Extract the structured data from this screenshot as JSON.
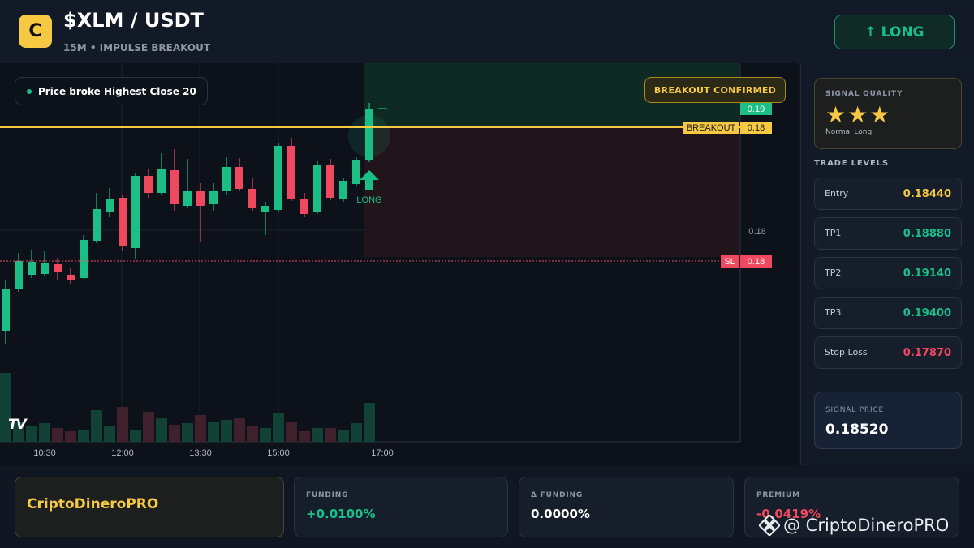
{
  "header": {
    "logo_letter": "C",
    "pair": "$XLM / USDT",
    "subtitle": "15M • IMPULSE BREAKOUT",
    "direction_button": "↑ LONG"
  },
  "chart": {
    "info_pill": "Price broke Highest Close 20",
    "badge": "BREAKOUT CONFIRMED",
    "long_marker_label": "LONG",
    "price_labels": {
      "current": "0.19",
      "breakout_tag": "BREAKOUT",
      "breakout_value": "0.18",
      "mid_axis": "0.18",
      "sl_tag": "SL",
      "sl_value": "0.18"
    },
    "time_labels": [
      "10:30",
      "12:00",
      "13:30",
      "15:00",
      "17:00"
    ],
    "tv_logo": "TV",
    "colors": {
      "up": "#1bbf85",
      "down": "#f0485f",
      "breakout": "#f7c842",
      "sl": "#f0485f"
    }
  },
  "chart_data": {
    "type": "candlestick",
    "x": [
      "10:30",
      "12:00",
      "13:30",
      "15:00",
      "17:00"
    ],
    "breakout_level": 0.184,
    "stop_loss": 0.1787,
    "current_price": 0.19
  },
  "signal_quality": {
    "title": "SIGNAL QUALITY",
    "stars": "★★★",
    "rating": 3,
    "subtitle": "Normal Long"
  },
  "trade_levels": {
    "title": "TRADE LEVELS",
    "items": [
      {
        "label": "Entry",
        "value": "0.18440",
        "color": "#f7c842"
      },
      {
        "label": "TP1",
        "value": "0.18880",
        "color": "#18c08b"
      },
      {
        "label": "TP2",
        "value": "0.19140",
        "color": "#18c08b"
      },
      {
        "label": "TP3",
        "value": "0.19400",
        "color": "#18c08b"
      },
      {
        "label": "Stop Loss",
        "value": "0.17870",
        "color": "#f0485f"
      }
    ]
  },
  "signal_price": {
    "label": "SIGNAL PRICE",
    "value": "0.18520"
  },
  "footer": {
    "brand": "CriptoDineroPRO",
    "stats": [
      {
        "label": "FUNDING",
        "value": "+0.0100%",
        "color": "#18c08b"
      },
      {
        "label": "Δ FUNDING",
        "value": "0.0000%",
        "color": "#ffffff"
      },
      {
        "label": "PREMIUM",
        "value": "-0.0419%",
        "color": "#f0485f"
      }
    ],
    "watermark": "@ CriptoDineroPRO"
  }
}
